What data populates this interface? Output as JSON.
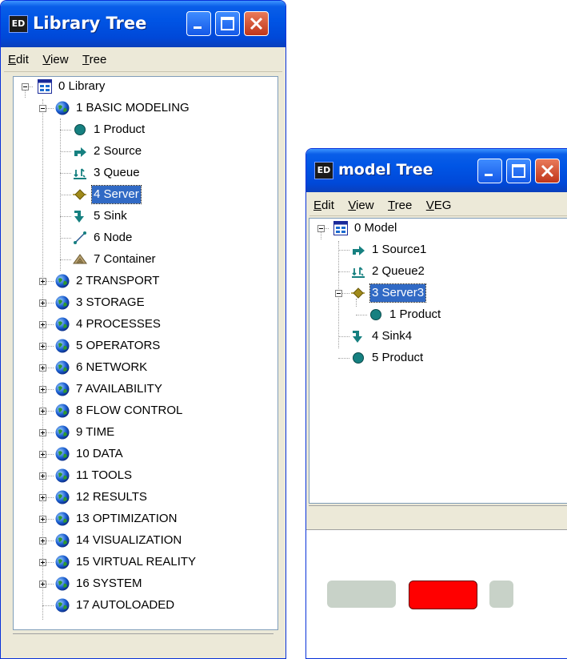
{
  "library_window": {
    "title": "Library Tree",
    "app_icon": "ED",
    "menu": [
      "Edit",
      "View",
      "Tree"
    ],
    "tree": [
      {
        "label": "0 Library",
        "icon": "library-icon",
        "expander": "minus"
      },
      {
        "label": "1 BASIC MODELING",
        "icon": "globe-icon",
        "expander": "minus"
      },
      {
        "label": "1 Product",
        "icon": "product-icon"
      },
      {
        "label": "2 Source",
        "icon": "source-icon"
      },
      {
        "label": "3 Queue",
        "icon": "queue-icon"
      },
      {
        "label": "4 Server",
        "icon": "server-icon",
        "selected": true
      },
      {
        "label": "5 Sink",
        "icon": "sink-icon"
      },
      {
        "label": "6 Node",
        "icon": "node-icon"
      },
      {
        "label": "7 Container",
        "icon": "container-icon"
      },
      {
        "label": "2 TRANSPORT",
        "icon": "globe-icon",
        "expander": "plus"
      },
      {
        "label": "3 STORAGE",
        "icon": "globe-icon",
        "expander": "plus"
      },
      {
        "label": "4 PROCESSES",
        "icon": "globe-icon",
        "expander": "plus"
      },
      {
        "label": "5 OPERATORS",
        "icon": "globe-icon",
        "expander": "plus"
      },
      {
        "label": "6 NETWORK",
        "icon": "globe-icon",
        "expander": "plus"
      },
      {
        "label": "7 AVAILABILITY",
        "icon": "globe-icon",
        "expander": "plus"
      },
      {
        "label": "8 FLOW CONTROL",
        "icon": "globe-icon",
        "expander": "plus"
      },
      {
        "label": "9 TIME",
        "icon": "globe-icon",
        "expander": "plus"
      },
      {
        "label": "10 DATA",
        "icon": "globe-icon",
        "expander": "plus"
      },
      {
        "label": "11 TOOLS",
        "icon": "globe-icon",
        "expander": "plus"
      },
      {
        "label": "12 RESULTS",
        "icon": "globe-icon",
        "expander": "plus"
      },
      {
        "label": "13 OPTIMIZATION",
        "icon": "globe-icon",
        "expander": "plus"
      },
      {
        "label": "14 VISUALIZATION",
        "icon": "globe-icon",
        "expander": "plus"
      },
      {
        "label": "15 VIRTUAL REALITY",
        "icon": "globe-icon",
        "expander": "plus"
      },
      {
        "label": "16 SYSTEM",
        "icon": "globe-icon",
        "expander": "plus"
      },
      {
        "label": "17 AUTOLOADED",
        "icon": "globe-icon"
      }
    ]
  },
  "model_window": {
    "title": "model Tree",
    "app_icon": "ED",
    "menu": [
      "Edit",
      "View",
      "Tree",
      "VEG"
    ],
    "tree": [
      {
        "label": "0 Model",
        "icon": "library-icon",
        "expander": "minus"
      },
      {
        "label": "1 Source1",
        "icon": "source-icon"
      },
      {
        "label": "2 Queue2",
        "icon": "queue-icon"
      },
      {
        "label": "3 Server3",
        "icon": "server-icon",
        "selected": true,
        "expander": "minus"
      },
      {
        "label": "1 Product",
        "icon": "product-icon"
      },
      {
        "label": "4 Sink4",
        "icon": "sink-icon"
      },
      {
        "label": "5 Product",
        "icon": "product-icon"
      }
    ]
  },
  "colors": {
    "titlebar": "#0055e5",
    "selection": "#316ac5",
    "teal": "#168080",
    "server_gold": "#a08a1a",
    "preview_gray": "#c8d2c8",
    "preview_red": "#ff0000"
  }
}
